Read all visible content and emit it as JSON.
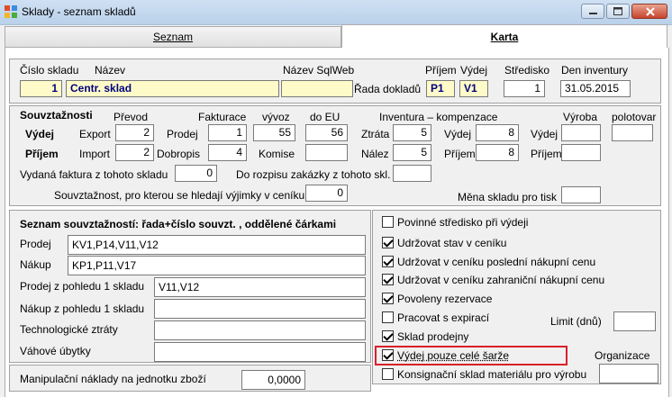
{
  "window": {
    "title": "Sklady - seznam skladů"
  },
  "tabs": [
    {
      "label": "Seznam"
    },
    {
      "label": "Karta"
    }
  ],
  "header": {
    "cislo_skladu_label": "Číslo skladu",
    "nazev_label": "Název",
    "nazev_sqlweb_label": "Název SqlWeb",
    "prijem_label": "Příjem",
    "vydej_label": "Výdej",
    "stredisko_label": "Středisko",
    "den_inventury_label": "Den inventury",
    "rada_dokladu_label": "Řada dokladů",
    "cislo_skladu": "1",
    "nazev": "Centr. sklad",
    "nazev_sqlweb": "",
    "rada_prijem": "P1",
    "rada_vydej": "V1",
    "stredisko": "1",
    "den_inventury": "31.05.2015"
  },
  "souvztaznosti": {
    "title": "Souvztažnosti",
    "prevod": "Převod",
    "fakturace": "Fakturace",
    "vyvoz": "vývoz",
    "do_eu": "do EU",
    "inventura": "Inventura – kompenzace",
    "vyroba": "Výroba",
    "polotovar": "polotovar",
    "vydej": "Výdej",
    "prijem": "Příjem",
    "export": "Export",
    "prodej": "Prodej",
    "import": "Import",
    "dobropis": "Dobropis",
    "komise": "Komise",
    "ztrata": "Ztráta",
    "nalez": "Nález",
    "inv_vydej": "Výdej",
    "inv_prijem": "Příjem",
    "vyr_vydej": "Výdej",
    "vyr_prijem": "Příjem",
    "v_export": "2",
    "v_prodej": "1",
    "v_vyvoz": "55",
    "v_doeu": "56",
    "v_ztrata": "5",
    "v_inv_vydej": "8",
    "v_vyr_vydej": "",
    "v_polotovar": "",
    "v_import": "2",
    "v_dobropis": "4",
    "v_komise": "",
    "v_nalez": "5",
    "v_inv_prijem": "8",
    "v_vyr_prijem": "",
    "faktura_label": "Vydaná faktura z tohoto skladu",
    "faktura_value": "0",
    "rozpis_label": "Do rozpisu zakázky z tohoto skl.",
    "rozpis_value": "",
    "vyjimky_label": "Souvztažnost, pro kterou se hledají výjimky v ceníku",
    "vyjimky_value": "0",
    "mena_label": "Měna skladu pro tisk",
    "mena_value": ""
  },
  "seznam": {
    "title": "Seznam souvztažností: řada+číslo souvzt. , oddělené čárkami",
    "rows": [
      {
        "label": "Prodej",
        "value": "KV1,P14,V11,V12"
      },
      {
        "label": "Nákup",
        "value": "KP1,P11,V17"
      },
      {
        "label": "Prodej z pohledu 1 skladu",
        "value": "V11,V12"
      },
      {
        "label": "Nákup z pohledu 1 skladu",
        "value": ""
      },
      {
        "label": "Technologické ztráty",
        "value": ""
      },
      {
        "label": "Váhové úbytky",
        "value": ""
      }
    ]
  },
  "checks": [
    {
      "label": "Povinné středisko při výdeji",
      "checked": false
    },
    {
      "label": "Udržovat stav v ceníku",
      "checked": true
    },
    {
      "label": "Udržovat v ceníku poslední nákupní cenu",
      "checked": true
    },
    {
      "label": "Udržovat v ceníku zahraniční nákupní cenu",
      "checked": true
    },
    {
      "label": "Povoleny rezervace",
      "checked": true
    },
    {
      "label": "Pracovat s expirací",
      "checked": false
    },
    {
      "label": "Sklad prodejny",
      "checked": true
    },
    {
      "label": "Výdej pouze celé šarže",
      "checked": true
    },
    {
      "label": "Konsignační sklad materiálu pro výrobu",
      "checked": false
    }
  ],
  "limit_label": "Limit (dnů)",
  "limit_value": "",
  "organizace_label": "Organizace",
  "organizace_value": "",
  "manip_label": "Manipulační náklady na jednotku zboží",
  "manip_value": "0,0000",
  "colors": {
    "highlight": "#d9202a",
    "input_yellow": "#fffbc8",
    "title_blue": "#b9d1ea"
  }
}
